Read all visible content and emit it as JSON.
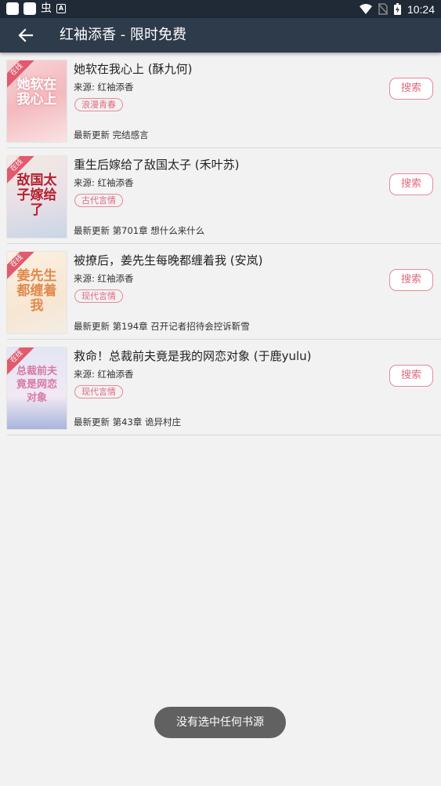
{
  "status_bar": {
    "time": "10:24",
    "left_glyph": "虫",
    "left_letter": "A",
    "icons": [
      "notification-square-icon",
      "notification-square-icon",
      "bug-icon",
      "a-box-icon",
      "wifi-icon",
      "no-sim-icon",
      "battery-icon"
    ]
  },
  "app_bar": {
    "title": "红袖添香 - 限时免费",
    "back_icon": "arrow-left-icon"
  },
  "colors": {
    "app_bar": "#2e3b4a",
    "status_bar": "#1f2a36",
    "accent": "#e06a7f",
    "background": "#f2f2f2"
  },
  "books": [
    {
      "title": "她软在我心上 (酥九何)",
      "source": "来源: 红袖添香",
      "tag": "浪漫青春",
      "latest": "最新更新 完结感言",
      "search_label": "搜索",
      "cover_ribbon": "在线",
      "cover_text": "她软在我心上"
    },
    {
      "title": "重生后嫁给了敌国太子 (禾叶苏)",
      "source": "来源: 红袖添香",
      "tag": "古代言情",
      "latest": "最新更新 第701章 想什么来什么",
      "search_label": "搜索",
      "cover_ribbon": "在线",
      "cover_text": "敌国太子嫁给了"
    },
    {
      "title": "被撩后，姜先生每晚都缠着我 (安岚)",
      "source": "来源: 红袖添香",
      "tag": "现代言情",
      "latest": "最新更新 第194章 召开记者招待会控诉靳雪",
      "search_label": "搜索",
      "cover_ribbon": "在线",
      "cover_text": "姜先生都缠着我"
    },
    {
      "title": "救命！总裁前夫竟是我的网恋对象 (于鹿yulu)",
      "source": "来源: 红袖添香",
      "tag": "现代言情",
      "latest": "最新更新 第43章 诡异村庄",
      "search_label": "搜索",
      "cover_ribbon": "在线",
      "cover_text": "总裁前夫竟是网恋对象"
    }
  ],
  "toast": "没有选中任何书源"
}
